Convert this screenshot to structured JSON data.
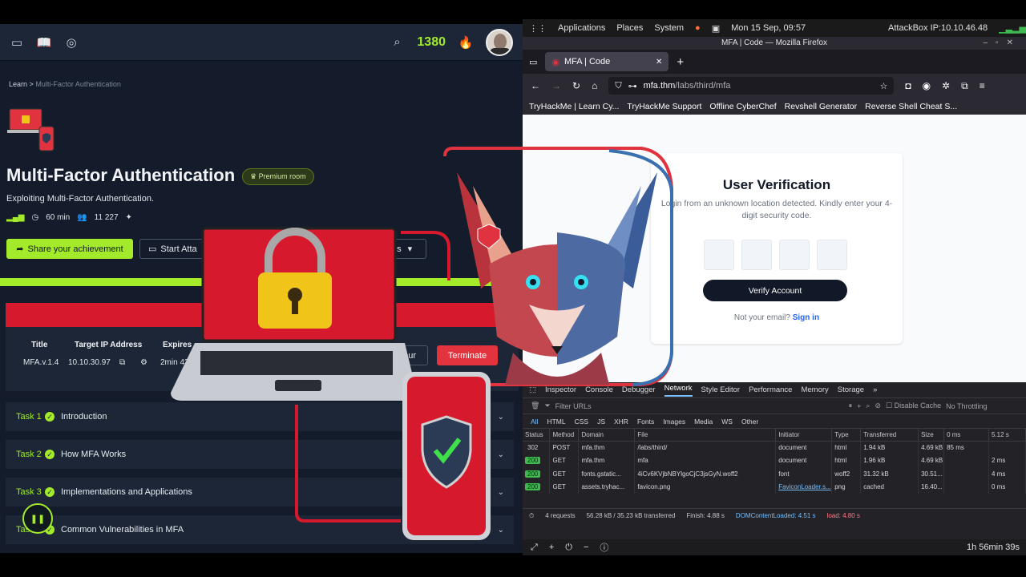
{
  "thm": {
    "score": "1380",
    "breadcrumb": {
      "root": "Learn",
      "sep": ">",
      "current": "Multi-Factor Authentication"
    },
    "title": "Multi-Factor Authentication",
    "premium": "Premium room",
    "subtitle": "Exploiting Multi-Factor Authentication.",
    "duration": "60 min",
    "users": "11 227",
    "share_btn": "Share your achievement",
    "attack_btn": "Start Atta",
    "options_btn": "ns",
    "machine": {
      "headers": [
        "Title",
        "Target IP Address",
        "Expires"
      ],
      "title": "MFA.v.1.4",
      "ip": "10.10.30.97",
      "expires": "2min 43",
      "hour_btn": "hour",
      "terminate_btn": "Terminate"
    },
    "tasks": [
      {
        "num": "Task 1",
        "label": "Introduction"
      },
      {
        "num": "Task 2",
        "label": "How MFA Works"
      },
      {
        "num": "Task 3",
        "label": "Implementations and Applications"
      },
      {
        "num": "Tas",
        "label": "Common Vulnerabilities in MFA"
      }
    ]
  },
  "desktop": {
    "menus": [
      "Applications",
      "Places",
      "System"
    ],
    "clock": "Mon 15 Sep, 09:57",
    "attackbox": "AttackBox IP:10.10.46.48"
  },
  "firefox": {
    "window_title": "MFA | Code — Mozilla Firefox",
    "tab": "MFA | Code",
    "url_host": "mfa.thm",
    "url_path": "/labs/third/mfa",
    "bookmarks": [
      "TryHackMe | Learn Cy...",
      "TryHackMe Support",
      "Offline CyberChef",
      "Revshell Generator",
      "Reverse Shell Cheat S..."
    ],
    "page": {
      "heading": "User Verification",
      "message": "Login from an unknown location detected. Kindly enter your 4-digit security code.",
      "verify_btn": "Verify Account",
      "not_email": "Not your email?",
      "sign_in": "Sign in"
    }
  },
  "devtools": {
    "tabs": [
      "Inspector",
      "Console",
      "Debugger",
      "Network",
      "Style Editor",
      "Performance",
      "Memory",
      "Storage"
    ],
    "filter_placeholder": "Filter URLs",
    "disable_cache": "Disable Cache",
    "throttling": "No Throttling",
    "types": [
      "All",
      "HTML",
      "CSS",
      "JS",
      "XHR",
      "Fonts",
      "Images",
      "Media",
      "WS",
      "Other"
    ],
    "columns": [
      "Status",
      "Method",
      "Domain",
      "File",
      "Initiator",
      "Type",
      "Transferred",
      "Size",
      "0 ms",
      "5.12 s"
    ],
    "rows": [
      {
        "status": "302",
        "method": "POST",
        "domain": "mfa.thm",
        "file": "/labs/third/",
        "initiator": "document",
        "type": "html",
        "transferred": "1.94 kB",
        "size": "4.69 kB",
        "timing": "85 ms"
      },
      {
        "status": "200",
        "method": "GET",
        "domain": "mfa.thm",
        "file": "mfa",
        "initiator": "document",
        "type": "html",
        "transferred": "1.96 kB",
        "size": "4.69 kB",
        "timing": "2 ms"
      },
      {
        "status": "200",
        "method": "GET",
        "domain": "fonts.gstatic...",
        "file": "4iCv6KVjbNBYlgoCjC3jsGyN.woff2",
        "initiator": "font",
        "type": "woff2",
        "transferred": "31.32 kB",
        "size": "30.51...",
        "timing": "4 ms"
      },
      {
        "status": "200",
        "method": "GET",
        "domain": "assets.tryhac...",
        "file": "favicon.png",
        "initiator": "FaviconLoader.s...",
        "type": "png",
        "transferred": "cached",
        "size": "16.40...",
        "timing": "0 ms"
      }
    ],
    "summary": {
      "requests": "4 requests",
      "transferred": "56.28 kB / 35.23 kB transferred",
      "finish": "Finish: 4.88 s",
      "dcl": "DOMContentLoaded: 4.51 s",
      "load": "load: 4.80 s"
    },
    "timer": "1h 56min 39s"
  }
}
